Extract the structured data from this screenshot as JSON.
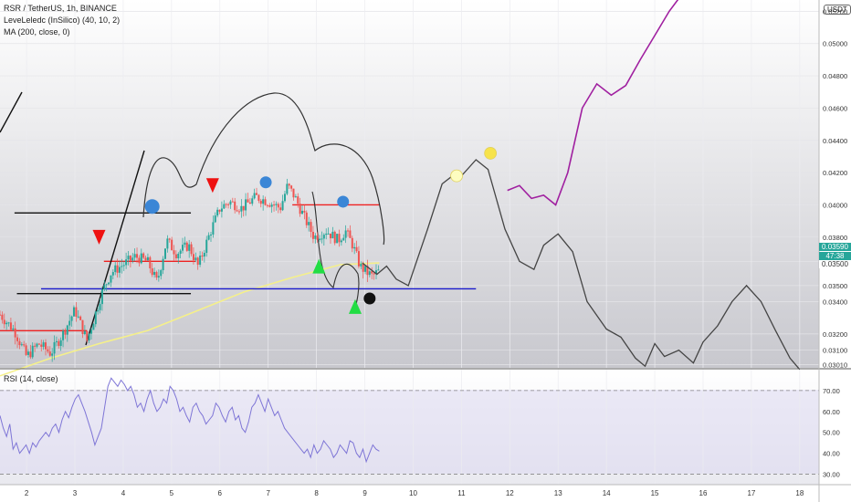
{
  "header": {
    "symbol_line": "RSR / TetherUS, 1h, BINANCE",
    "indicator1": "LeveLeledc (InSilico) (40, 10, 2)",
    "indicator2": "MA (200, close, 0)",
    "rsi_label": "RSI (14, close)",
    "currency": "USDT"
  },
  "price_tags": {
    "last_price": "0.03590",
    "countdown": "47:38",
    "level": "0.03500"
  },
  "colors": {
    "bull": "#26a69a",
    "bear": "#ef5350",
    "ma": "#f5f08a",
    "rsi": "#7e75d6",
    "blue_line": "#1a1acc",
    "projection": "#444444",
    "purple": "#a020a0"
  },
  "chart_data": [
    {
      "type": "candlestick",
      "title": "RSR / TetherUS, 1h, BINANCE",
      "x_ticks": [
        "2",
        "3",
        "4",
        "5",
        "6",
        "7",
        "8",
        "9",
        "10",
        "11",
        "12",
        "13",
        "14",
        "15",
        "16",
        "17",
        "18"
      ],
      "y_ticks": [
        "0.03010",
        "0.03100",
        "0.03200",
        "0.03400",
        "0.03500",
        "0.03650",
        "0.03800",
        "0.04000",
        "0.04200",
        "0.04400",
        "0.04600",
        "0.04800",
        "0.05000",
        "0.05200"
      ],
      "ylim": [
        0.0299,
        0.0527
      ],
      "xlim": [
        1.45,
        18.4
      ],
      "candle_path": [
        [
          1.45,
          0.0332
        ],
        [
          1.75,
          0.0322
        ],
        [
          2.0,
          0.0306
        ],
        [
          2.25,
          0.0314
        ],
        [
          2.5,
          0.0308
        ],
        [
          2.75,
          0.032
        ],
        [
          3.0,
          0.0335
        ],
        [
          3.25,
          0.0316
        ],
        [
          3.4,
          0.033
        ],
        [
          3.55,
          0.0345
        ],
        [
          3.75,
          0.0358
        ],
        [
          4.0,
          0.0363
        ],
        [
          4.25,
          0.0368
        ],
        [
          4.5,
          0.0365
        ],
        [
          4.7,
          0.0352
        ],
        [
          4.9,
          0.0378
        ],
        [
          5.1,
          0.037
        ],
        [
          5.35,
          0.0375
        ],
        [
          5.55,
          0.0362
        ],
        [
          5.8,
          0.0383
        ],
        [
          6.0,
          0.0398
        ],
        [
          6.2,
          0.0402
        ],
        [
          6.45,
          0.0398
        ],
        [
          6.75,
          0.0405
        ],
        [
          7.0,
          0.0402
        ],
        [
          7.25,
          0.0398
        ],
        [
          7.4,
          0.0412
        ],
        [
          7.55,
          0.0405
        ],
        [
          7.75,
          0.0392
        ],
        [
          7.95,
          0.038
        ],
        [
          8.2,
          0.0384
        ],
        [
          8.45,
          0.0378
        ],
        [
          8.6,
          0.0384
        ],
        [
          8.75,
          0.0375
        ],
        [
          8.9,
          0.0362
        ],
        [
          9.05,
          0.0358
        ],
        [
          9.15,
          0.0356
        ],
        [
          9.3,
          0.0359
        ]
      ],
      "ma_200": [
        [
          1.45,
          0.0294
        ],
        [
          2.5,
          0.0305
        ],
        [
          3.5,
          0.0314
        ],
        [
          4.5,
          0.0322
        ],
        [
          5.5,
          0.0334
        ],
        [
          6.5,
          0.0346
        ],
        [
          7.5,
          0.0355
        ],
        [
          8.5,
          0.0363
        ],
        [
          9.3,
          0.0364
        ]
      ],
      "horizontal_levels": [
        {
          "color": "red",
          "y": 0.0322,
          "x1": 1.45,
          "x2": 3.25
        },
        {
          "color": "red",
          "y": 0.0365,
          "x1": 3.6,
          "x2": 5.5
        },
        {
          "color": "red",
          "y": 0.04,
          "x1": 7.5,
          "x2": 9.3
        },
        {
          "color": "black",
          "y": 0.0395,
          "x1": 1.75,
          "x2": 5.4
        },
        {
          "color": "black",
          "y": 0.0345,
          "x1": 1.8,
          "x2": 5.4
        },
        {
          "color": "blue",
          "y": 0.0348,
          "x1": 2.3,
          "x2": 11.3
        }
      ],
      "projection": [
        [
          8.95,
          0.0364
        ],
        [
          9.25,
          0.0357
        ],
        [
          9.45,
          0.0362
        ],
        [
          9.65,
          0.0354
        ],
        [
          9.9,
          0.035
        ],
        [
          10.3,
          0.0385
        ],
        [
          10.6,
          0.0413
        ],
        [
          10.9,
          0.042
        ],
        [
          11.0,
          0.0418
        ],
        [
          11.3,
          0.0428
        ],
        [
          11.55,
          0.0422
        ],
        [
          11.9,
          0.0385
        ],
        [
          12.2,
          0.0365
        ],
        [
          12.5,
          0.036
        ],
        [
          12.7,
          0.0375
        ],
        [
          13.0,
          0.0382
        ],
        [
          13.3,
          0.0371
        ],
        [
          13.6,
          0.034
        ],
        [
          14.0,
          0.0323
        ],
        [
          14.3,
          0.0318
        ],
        [
          14.6,
          0.0305
        ],
        [
          14.8,
          0.03
        ],
        [
          15.0,
          0.0314
        ],
        [
          15.2,
          0.0306
        ],
        [
          15.5,
          0.031
        ],
        [
          15.8,
          0.0302
        ],
        [
          16.0,
          0.0315
        ],
        [
          16.3,
          0.0325
        ],
        [
          16.6,
          0.034
        ],
        [
          16.9,
          0.035
        ],
        [
          17.2,
          0.034
        ],
        [
          17.5,
          0.0322
        ],
        [
          17.8,
          0.0305
        ],
        [
          18.0,
          0.0298
        ]
      ],
      "purple_projection": [
        [
          11.95,
          0.0409
        ],
        [
          12.2,
          0.0412
        ],
        [
          12.45,
          0.0404
        ],
        [
          12.7,
          0.0406
        ],
        [
          12.95,
          0.04
        ],
        [
          13.2,
          0.042
        ],
        [
          13.5,
          0.046
        ],
        [
          13.8,
          0.0475
        ],
        [
          14.1,
          0.0468
        ],
        [
          14.4,
          0.0474
        ],
        [
          14.7,
          0.049
        ],
        [
          15.0,
          0.0505
        ],
        [
          15.3,
          0.052
        ],
        [
          15.5,
          0.0528
        ]
      ],
      "signals": [
        {
          "shape": "triangle-down",
          "color": "#ee1111",
          "x": 3.5,
          "y": 0.038
        },
        {
          "shape": "triangle-down",
          "color": "#ee1111",
          "x": 5.85,
          "y": 0.0412
        },
        {
          "shape": "circle",
          "color": "#3b86d6",
          "x": 4.6,
          "y": 0.0399
        },
        {
          "shape": "circle",
          "color": "#3b86d6",
          "x": 6.95,
          "y": 0.0414
        },
        {
          "shape": "circle",
          "color": "#3b86d6",
          "x": 8.55,
          "y": 0.0402
        },
        {
          "shape": "triangle-up",
          "color": "#22dd44",
          "x": 8.05,
          "y": 0.0362
        },
        {
          "shape": "triangle-up",
          "color": "#22dd44",
          "x": 8.8,
          "y": 0.0337
        },
        {
          "shape": "circle",
          "color": "#111111",
          "x": 9.1,
          "y": 0.0342
        },
        {
          "shape": "circle",
          "color": "#fdfdc0",
          "x": 10.9,
          "y": 0.0418
        },
        {
          "shape": "circle",
          "color": "#f7e34a",
          "x": 11.6,
          "y": 0.0432
        }
      ]
    },
    {
      "type": "line",
      "title": "RSI (14, close)",
      "y_ticks": [
        "30.00",
        "40.00",
        "50.00",
        "60.00",
        "70.00"
      ],
      "ylim": [
        25,
        80
      ],
      "reference_lines": [
        70,
        30
      ],
      "x_range": [
        1.45,
        9.3
      ],
      "values": [
        58,
        52,
        48,
        54,
        42,
        45,
        40,
        42,
        44,
        40,
        45,
        43,
        46,
        48,
        50,
        48,
        52,
        54,
        50,
        56,
        60,
        57,
        62,
        66,
        68,
        64,
        60,
        55,
        50,
        44,
        48,
        52,
        62,
        72,
        76,
        74,
        72,
        75,
        73,
        70,
        72,
        68,
        62,
        64,
        60,
        66,
        70,
        64,
        60,
        62,
        66,
        64,
        72,
        70,
        66,
        60,
        62,
        58,
        55,
        62,
        64,
        60,
        58,
        54,
        56,
        58,
        64,
        62,
        58,
        55,
        60,
        62,
        56,
        58,
        52,
        50,
        55,
        62,
        64,
        68,
        64,
        60,
        66,
        62,
        58,
        60,
        56,
        52,
        50,
        48,
        46,
        44,
        42,
        40,
        42,
        38,
        44,
        40,
        42,
        46,
        44,
        42,
        38,
        40,
        44,
        42,
        40,
        46,
        45,
        40,
        38,
        42,
        36,
        40,
        44,
        42,
        41
      ]
    }
  ]
}
